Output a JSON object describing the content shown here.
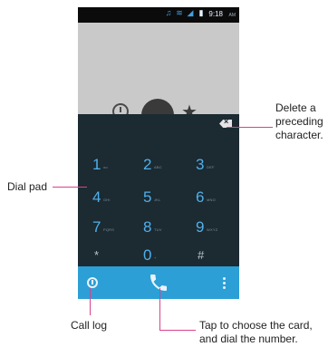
{
  "status_bar": {
    "time": "9:18",
    "ampm": "AM",
    "icons": [
      "headset-icon",
      "wifi-icon",
      "signal-icon",
      "battery-icon"
    ]
  },
  "contact_area": {
    "quick_actions": [
      "recent-icon",
      "avatar-icon",
      "favorite-star-icon"
    ]
  },
  "dialpad": {
    "keys": [
      {
        "digit": "1",
        "letters": "oo"
      },
      {
        "digit": "2",
        "letters": "ABC"
      },
      {
        "digit": "3",
        "letters": "DEF"
      },
      {
        "digit": "4",
        "letters": "GHI"
      },
      {
        "digit": "5",
        "letters": "JKL"
      },
      {
        "digit": "6",
        "letters": "MNO"
      },
      {
        "digit": "7",
        "letters": "PQRS"
      },
      {
        "digit": "8",
        "letters": "TUV"
      },
      {
        "digit": "9",
        "letters": "WXYZ"
      },
      {
        "digit": "*",
        "letters": ""
      },
      {
        "digit": "0",
        "letters": "+"
      },
      {
        "digit": "#",
        "letters": ""
      }
    ]
  },
  "action_bar": {
    "icons": [
      "call-log-icon",
      "phone-call-icon",
      "overflow-menu-icon"
    ]
  },
  "annotations": {
    "delete_line1": "Delete a",
    "delete_line2": "preceding",
    "delete_line3": "character.",
    "dial_pad": "Dial pad",
    "call_log": "Call log",
    "tap_line1": "Tap to choose the card,",
    "tap_line2": "and dial the number."
  },
  "colors": {
    "dialpad_bg": "#1c2a32",
    "digit": "#4fb0ea",
    "action_bar": "#2c9fd6",
    "leader_line": "#d9418c"
  }
}
